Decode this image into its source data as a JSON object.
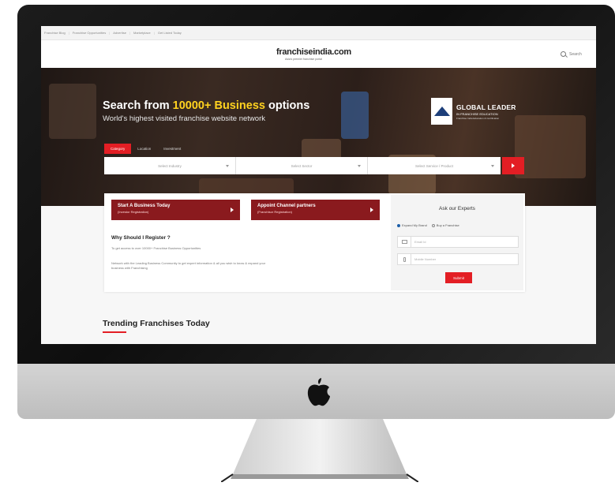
{
  "utility_bar": {
    "links": [
      "Franchise Blog",
      "Franchise Opportunities",
      "Advertise",
      "Marketplace",
      "Get Listed Today"
    ]
  },
  "header": {
    "logo": "franchiseindia.com",
    "logo_tagline": "Asia's premier franchise portal",
    "search_label": "Search"
  },
  "hero": {
    "title_before": "Search from ",
    "title_highlight": "10000+ Business",
    "title_after": " options",
    "subtitle": "World's highest visited franchise website network",
    "badge": {
      "line1": "GLOBAL LEADER",
      "line2": "IN FRANCHISE EDUCATION",
      "line3": "Franchise India Education & Certification"
    },
    "tabs": [
      {
        "label": "Category",
        "active": true
      },
      {
        "label": "Location",
        "active": false
      },
      {
        "label": "Investment",
        "active": false
      }
    ],
    "filters": {
      "industry": "Select Industry",
      "sector": "Select Sector",
      "service": "Select Service / Product"
    }
  },
  "cta_primary": {
    "title": "Start A Business Today",
    "subtitle": "(Investor Registration)"
  },
  "cta_secondary": {
    "title": "Appoint Channel partners",
    "subtitle": "(Franchisor Registration)"
  },
  "why_register": {
    "title": "Why Should I Register ?",
    "line1": "To get access to over 10000+ Franchise Business Opportunities",
    "line2": "Network with the Leading Business Community to get expert information & all you wish to know & expand your",
    "line3": "business with Franchising"
  },
  "ask_experts": {
    "title": "Ask our Experts",
    "options": [
      {
        "label": "Expand My Brand",
        "selected": true
      },
      {
        "label": "Buy a Franchise",
        "selected": false
      }
    ],
    "email_placeholder": "Email Id",
    "mobile_placeholder": "Mobile Number",
    "submit_label": "Submit"
  },
  "trending": {
    "title": "Trending Franchises Today"
  },
  "colors": {
    "brand_red": "#e31e24",
    "cta_dark_red": "#8a1a1e",
    "highlight_yellow": "#ffd21f"
  }
}
